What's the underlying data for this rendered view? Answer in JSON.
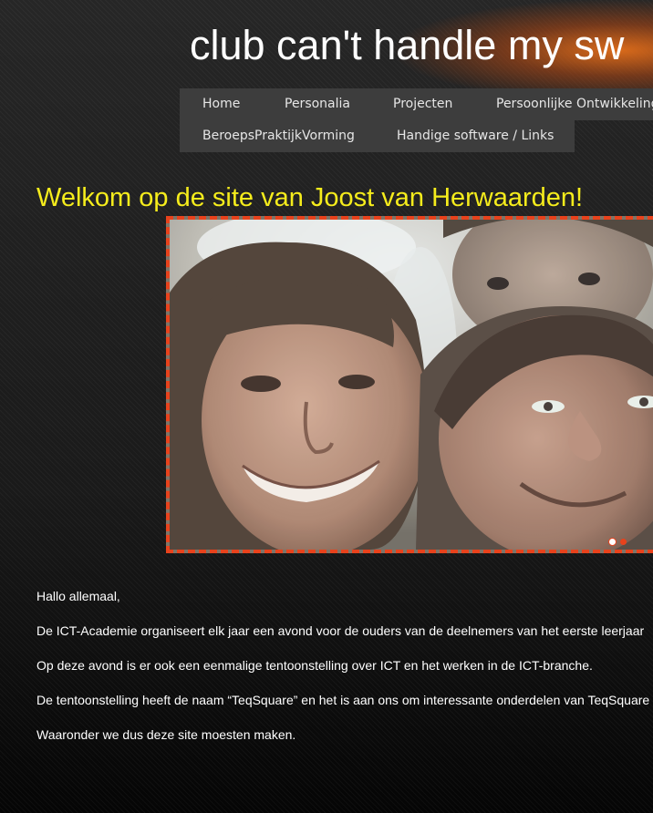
{
  "site": {
    "title": "club can't handle my sw"
  },
  "nav": {
    "row1": [
      "Home",
      "Personalia",
      "Projecten",
      "Persoonlijke Ontwikkeling"
    ],
    "row2": [
      "BeroepsPraktijkVorming",
      "Handige software / Links"
    ]
  },
  "main": {
    "heading": "Welkom op de site van Joost van Herwaarden!",
    "slideshow": {
      "slide_count": 2,
      "active_slide": 1
    },
    "paragraphs": [
      "Hallo allemaal,",
      "De ICT-Academie organiseert elk jaar een avond voor de ouders van de deelnemers van het eerste leerjaar",
      "Op deze avond is er ook een eenmalige tentoonstelling over ICT en het werken in de ICT-branche.",
      "De tentoonstelling heeft de naam “TeqSquare” en het is aan ons om interessante onderdelen van TeqSquare",
      "Waaronder we dus deze site moesten maken."
    ]
  },
  "colors": {
    "heading": "#f5ec1c",
    "slideshow_border": "#e8421c",
    "nav_background": "#3d3d3d",
    "title_glow": "#e36e1a"
  }
}
